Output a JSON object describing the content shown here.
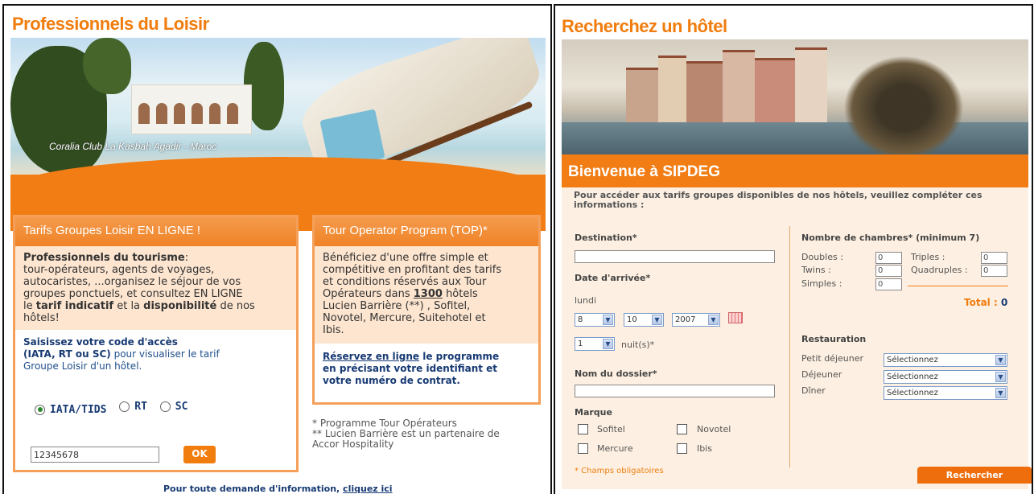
{
  "left": {
    "title": "Professionnels du Loisir",
    "hero_caption": "Coralia Club La Kasbah Agadir - Maroc",
    "box1": {
      "header": "Tarifs Groupes Loisir EN LIGNE !",
      "p1_bold": "Professionnels du tourisme",
      "p1_line1": "tour-opérateurs, agents de voyages,",
      "p1_line2": "autocaristes, ...organisez le séjour de vos",
      "p1_line3": "groupes ponctuels, et consultez EN LIGNE",
      "p1_line4a": "le ",
      "p1_line4b": "tarif indicatif",
      "p1_line4c": " et la ",
      "p1_line4d": "disponibilité",
      "p1_line4e": " de nos",
      "p1_line5": "hôtels!",
      "p2_bold1": "Saisissez votre code d'accès",
      "p2_bold2": "(IATA, RT ou SC)",
      "p2_rest1": " pour visualiser le tarif",
      "p2_rest2": "Groupe Loisir d'un hôtel.",
      "radios": [
        "IATA/TIDS",
        "RT",
        "SC"
      ],
      "code_value": "12345678",
      "ok_label": "OK"
    },
    "box2": {
      "header": "Tour Operator Program (TOP)*",
      "l1": "Bénéficiez d'une offre simple et",
      "l2": "compétitive en profitant des tarifs",
      "l3": "et conditions réservés aux Tour",
      "l4a": "Opérateurs dans ",
      "l4b": "1300",
      "l4c": " hôtels",
      "l5": "Lucien Barrière (**) , Sofitel,",
      "l6": "Novotel, Mercure, Suitehotel et",
      "l7": "Ibis.",
      "cta_link": "Réservez en ligne",
      "cta_rest1": " le programme",
      "cta_rest2": "en précisant votre identifiant et",
      "cta_rest3": "votre numéro de contrat."
    },
    "notes": [
      "* Programme Tour Opérateurs",
      "** Lucien Barrière est un partenaire de",
      "Accor Hospitality"
    ],
    "footer_text": "Pour toute demande d'information, ",
    "footer_link": "cliquez ici"
  },
  "right": {
    "title": "Recherchez un hôtel",
    "welcome": "Bienvenue à  SIPDEG",
    "intro": "Pour accéder aux tarifs groupes disponibles de nos hôtels, veuillez compléter ces informations :",
    "destination_label": "Destination*",
    "date_label": "Date d'arrivée*",
    "day_name": "lundi",
    "day": "8",
    "month": "10",
    "year": "2007",
    "nights": "1",
    "nights_label": "nuit(s)*",
    "dossier_label": "Nom du dossier*",
    "marque_label": "Marque",
    "brands": [
      "Sofitel",
      "Novotel",
      "Mercure",
      "Ibis"
    ],
    "required_note": "* Champs obligatoires",
    "rooms_label": "Nombre de chambres* (minimum 7)",
    "rooms": {
      "doubles": "Doubles :",
      "triples": "Triples :",
      "twins": "Twins :",
      "quadruples": "Quadruples :",
      "simples": "Simples :"
    },
    "room_default": "0",
    "total_label": "Total : ",
    "total_value": "0",
    "restauration_label": "Restauration",
    "meals": [
      "Petit déjeuner",
      "Déjeuner",
      "Dîner"
    ],
    "meal_select": "Sélectionnez",
    "search_button": "Rechercher"
  },
  "colors": {
    "orange": "#f07d0e",
    "peach": "#fde5cf",
    "navy": "#173a73"
  }
}
